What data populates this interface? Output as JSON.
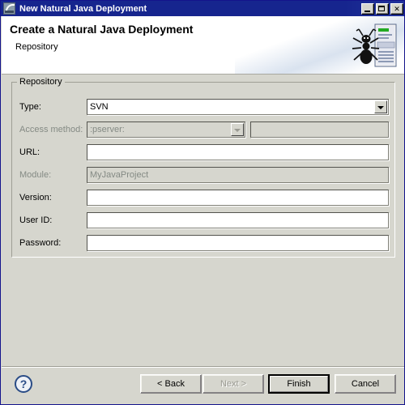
{
  "window": {
    "title": "New Natural Java Deployment",
    "icon": "natural-java-icon",
    "buttons": {
      "minimize": "minimize-icon",
      "maximize": "maximize-icon",
      "close": "✕"
    }
  },
  "header": {
    "title": "Create a Natural Java Deployment",
    "subtitle": "Repository",
    "icon": "ant-deployment-icon"
  },
  "group": {
    "label": "Repository",
    "rows": [
      {
        "label": "Type:",
        "control": "combo",
        "value": "SVN",
        "disabled": false,
        "name": "type"
      },
      {
        "label": "Access method:",
        "control": "combo-plus-field",
        "value": ":pserver:",
        "extra_value": "",
        "disabled": true,
        "name": "access-method"
      },
      {
        "label": "URL:",
        "control": "text",
        "value": "",
        "disabled": false,
        "name": "url"
      },
      {
        "label": "Module:",
        "control": "text",
        "value": "MyJavaProject",
        "disabled": true,
        "name": "module"
      },
      {
        "label": "Version:",
        "control": "text",
        "value": "",
        "disabled": false,
        "name": "version"
      },
      {
        "label": "User ID:",
        "control": "text",
        "value": "",
        "disabled": false,
        "name": "user-id"
      },
      {
        "label": "Password:",
        "control": "text",
        "value": "",
        "disabled": false,
        "name": "password"
      }
    ]
  },
  "footer": {
    "help_icon": "help-question-icon",
    "back_label": "< Back",
    "next_label": "Next >",
    "finish_label": "Finish",
    "cancel_label": "Cancel"
  },
  "colors": {
    "titlebar": "#14258c",
    "dialog_bg": "#d6d6ce",
    "header_bg": "#ffffff",
    "disabled_text": "#848a84",
    "field_bg": "#ffffff"
  }
}
